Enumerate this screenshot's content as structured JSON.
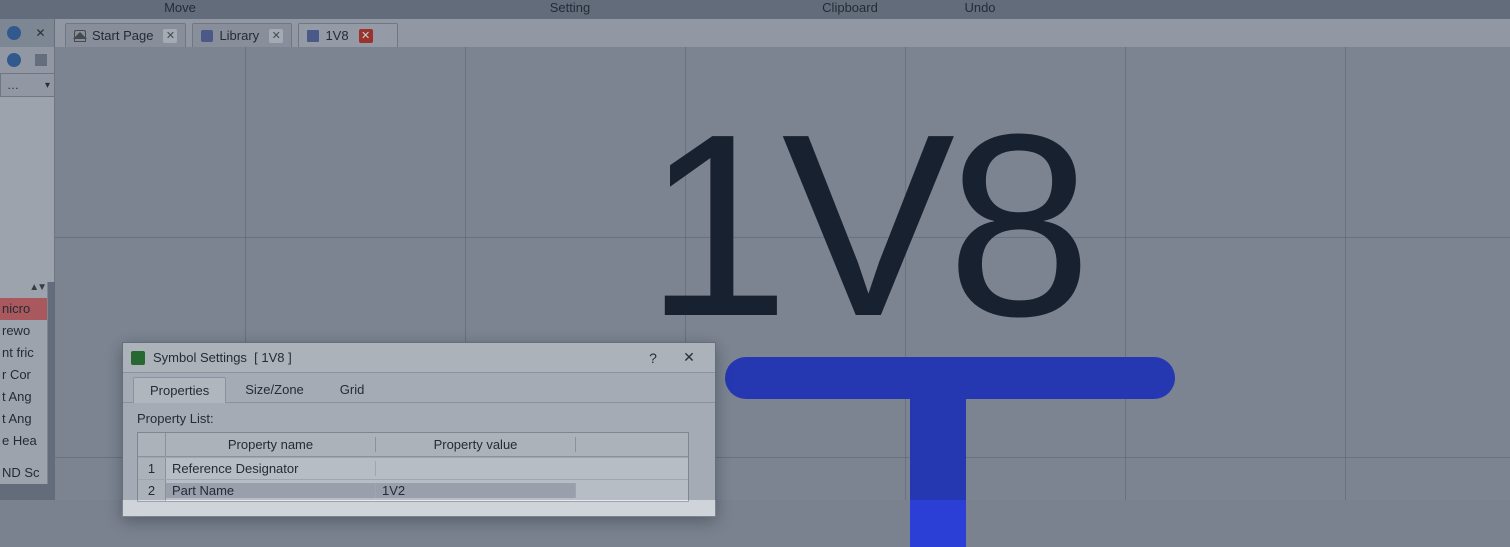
{
  "ribbon": {
    "move": "Move",
    "setting": "Setting",
    "clipboard": "Clipboard",
    "undo": "Undo"
  },
  "tabs": {
    "start": "Start Page",
    "library": "Library",
    "current": "1V8"
  },
  "side_items": [
    "nicro",
    "rewo",
    "nt fric",
    "r Cor",
    "t Ang",
    "t Ang",
    "e Hea",
    "ND Sc"
  ],
  "canvas": {
    "net_label": "1V8"
  },
  "dialog": {
    "title_prefix": "Symbol Settings",
    "title_subject": "[ 1V8 ]",
    "tabs": {
      "properties": "Properties",
      "sizezone": "Size/Zone",
      "grid": "Grid"
    },
    "list_label": "Property List:",
    "columns": {
      "name": "Property name",
      "value": "Property value"
    },
    "rows": [
      {
        "idx": "1",
        "name": "Reference Designator",
        "value": ""
      },
      {
        "idx": "2",
        "name": "Part Name",
        "value": "1V2"
      }
    ]
  }
}
